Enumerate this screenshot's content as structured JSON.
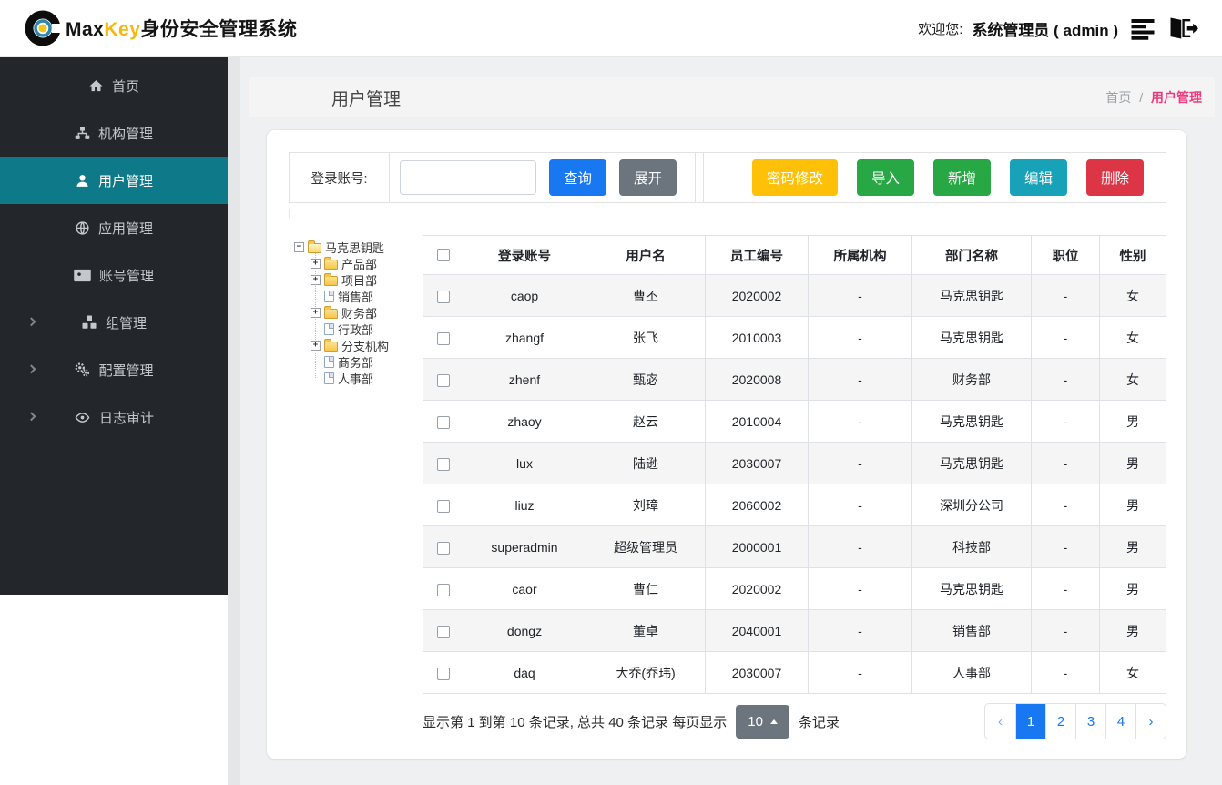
{
  "header": {
    "brand": {
      "max": "Max",
      "key": "Key",
      "suffix": "身份安全管理系统"
    },
    "welcome_label": "欢迎您:",
    "username": "系统管理员 ( admin )"
  },
  "sidebar": {
    "items": [
      {
        "id": "home",
        "label": "首页",
        "icon": "home-icon",
        "active": false,
        "expandable": false
      },
      {
        "id": "org",
        "label": "机构管理",
        "icon": "sitemap-icon",
        "active": false,
        "expandable": false
      },
      {
        "id": "user",
        "label": "用户管理",
        "icon": "user-icon",
        "active": true,
        "expandable": false
      },
      {
        "id": "app",
        "label": "应用管理",
        "icon": "globe-icon",
        "active": false,
        "expandable": false
      },
      {
        "id": "account",
        "label": "账号管理",
        "icon": "id-card-icon",
        "active": false,
        "expandable": false
      },
      {
        "id": "group",
        "label": "组管理",
        "icon": "cubes-icon",
        "active": false,
        "expandable": true
      },
      {
        "id": "config",
        "label": "配置管理",
        "icon": "gears-icon",
        "active": false,
        "expandable": true
      },
      {
        "id": "audit",
        "label": "日志审计",
        "icon": "eye-icon",
        "active": false,
        "expandable": true
      }
    ]
  },
  "page_header": {
    "title": "用户管理",
    "breadcrumb": {
      "home": "首页",
      "separator": "/",
      "current": "用户管理"
    }
  },
  "search_form": {
    "label": "登录账号:",
    "input_value": "",
    "query_button": "查询",
    "expand_button": "展开"
  },
  "action_buttons": [
    {
      "id": "change-password",
      "label": "密码修改",
      "color": "#ffc107"
    },
    {
      "id": "import",
      "label": "导入",
      "color": "#28a745"
    },
    {
      "id": "add",
      "label": "新增",
      "color": "#28a745"
    },
    {
      "id": "edit",
      "label": "编辑",
      "color": "#17a2b8"
    },
    {
      "id": "delete",
      "label": "删除",
      "color": "#dc3545"
    }
  ],
  "org_tree": {
    "root": {
      "label": "马克思钥匙",
      "expander": "-",
      "icon": "open-folder-icon"
    },
    "children": [
      {
        "label": "产品部",
        "expander": "+",
        "icon": "folder-icon"
      },
      {
        "label": "项目部",
        "expander": "+",
        "icon": "folder-icon"
      },
      {
        "label": "销售部",
        "expander": "",
        "icon": "file-icon"
      },
      {
        "label": "财务部",
        "expander": "+",
        "icon": "folder-icon"
      },
      {
        "label": "行政部",
        "expander": "",
        "icon": "file-icon"
      },
      {
        "label": "分支机构",
        "expander": "+",
        "icon": "folder-icon"
      },
      {
        "label": "商务部",
        "expander": "",
        "icon": "file-icon"
      },
      {
        "label": "人事部",
        "expander": "",
        "icon": "file-icon"
      }
    ]
  },
  "user_table": {
    "columns": [
      "登录账号",
      "用户名",
      "员工编号",
      "所属机构",
      "部门名称",
      "职位",
      "性别"
    ],
    "rows": [
      [
        "caop",
        "曹丕",
        "2020002",
        "-",
        "马克思钥匙",
        "-",
        "女"
      ],
      [
        "zhangf",
        "张飞",
        "2010003",
        "-",
        "马克思钥匙",
        "-",
        "女"
      ],
      [
        "zhenf",
        "甄宓",
        "2020008",
        "-",
        "财务部",
        "-",
        "女"
      ],
      [
        "zhaoy",
        "赵云",
        "2010004",
        "-",
        "马克思钥匙",
        "-",
        "男"
      ],
      [
        "lux",
        "陆逊",
        "2030007",
        "-",
        "马克思钥匙",
        "-",
        "男"
      ],
      [
        "liuz",
        "刘璋",
        "2060002",
        "-",
        "深圳分公司",
        "-",
        "男"
      ],
      [
        "superadmin",
        "超级管理员",
        "2000001",
        "-",
        "科技部",
        "-",
        "男"
      ],
      [
        "caor",
        "曹仁",
        "2020002",
        "-",
        "马克思钥匙",
        "-",
        "男"
      ],
      [
        "dongz",
        "董卓",
        "2040001",
        "-",
        "销售部",
        "-",
        "男"
      ],
      [
        "daq",
        "大乔(乔玮)",
        "2030007",
        "-",
        "人事部",
        "-",
        "女"
      ]
    ]
  },
  "pagination": {
    "summary_prefix": "显示第 1 到第 10 条记录, 总共 40 条记录  每页显示",
    "page_size": "10",
    "summary_suffix": "条记录",
    "prev": "‹",
    "next": "›",
    "pages": [
      "1",
      "2",
      "3",
      "4"
    ],
    "active_page": "1"
  },
  "colors": {
    "primary": "#1778f2",
    "success": "#28a745",
    "info": "#17a2b8",
    "warning": "#ffc107",
    "danger": "#dc3545",
    "secondary": "#6c757d",
    "sidebar_bg": "#23272c",
    "sidebar_active": "#0e7988",
    "breadcrumb_active": "#ee3b7d",
    "brand_key": "#f5b80c"
  }
}
